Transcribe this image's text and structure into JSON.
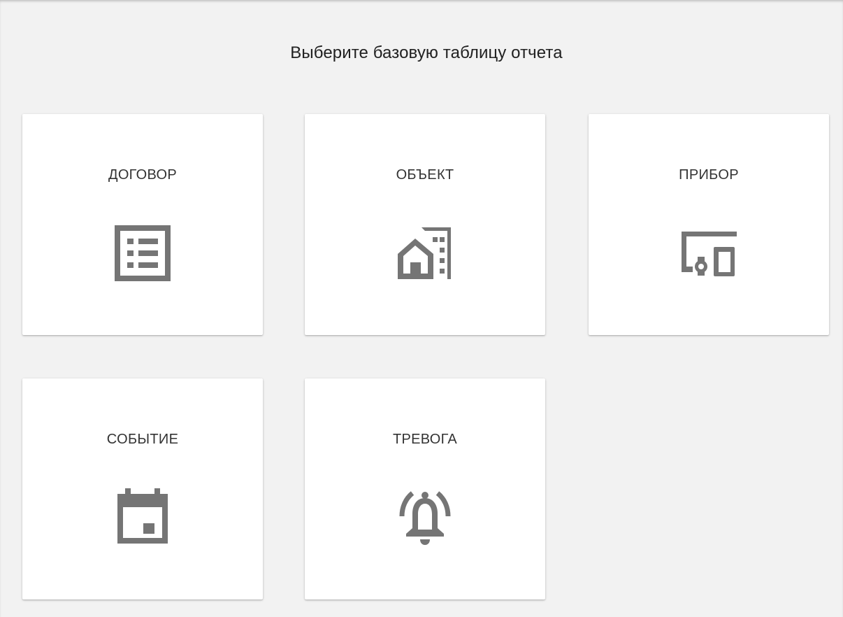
{
  "page": {
    "heading": "Выберите базовую таблицу отчета"
  },
  "cards": [
    {
      "label": "ДОГОВОР",
      "icon": "list-document-icon"
    },
    {
      "label": "ОБЪЕКТ",
      "icon": "buildings-icon"
    },
    {
      "label": "ПРИБОР",
      "icon": "devices-icon"
    },
    {
      "label": "СОБЫТИЕ",
      "icon": "calendar-event-icon"
    },
    {
      "label": "ТРЕВОГА",
      "icon": "alarm-bell-icon"
    }
  ],
  "colors": {
    "background": "#f2f2f2",
    "card": "#ffffff",
    "icon": "#757575",
    "text": "#212121"
  }
}
